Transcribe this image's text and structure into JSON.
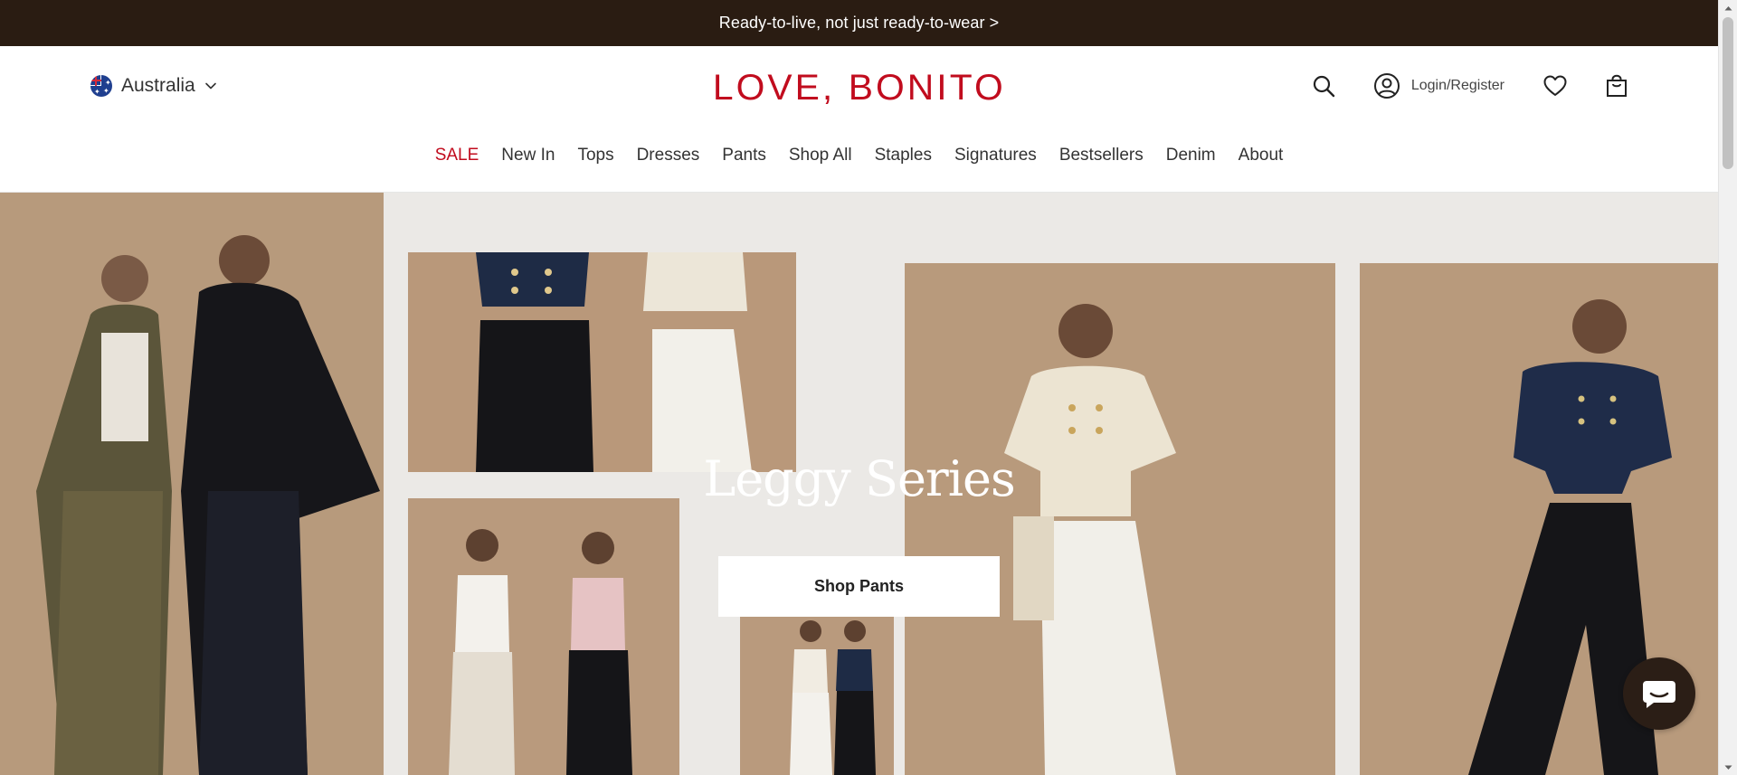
{
  "announcement": {
    "text": "Ready-to-live, not just ready-to-wear >"
  },
  "header": {
    "region": {
      "label": "Australia",
      "flag_icon": "australia-flag-icon"
    },
    "logo": "LOVE, BONITO",
    "login_label": "Login/Register",
    "icons": [
      "search-icon",
      "account-icon",
      "heart-icon",
      "shopping-bag-icon"
    ]
  },
  "nav": {
    "items": [
      {
        "label": "SALE",
        "highlight": true
      },
      {
        "label": "New In"
      },
      {
        "label": "Tops"
      },
      {
        "label": "Dresses"
      },
      {
        "label": "Pants"
      },
      {
        "label": "Shop All"
      },
      {
        "label": "Staples"
      },
      {
        "label": "Signatures"
      },
      {
        "label": "Bestsellers"
      },
      {
        "label": "Denim"
      },
      {
        "label": "About"
      }
    ]
  },
  "hero": {
    "title": "Leggy Series",
    "cta_label": "Shop Pants"
  },
  "colors": {
    "announce_bg": "#2a1c12",
    "brand": "#c10c1e",
    "hero_bg": "#ebe9e6",
    "tan": "#b99b7f",
    "chat_bg": "#2b1e16"
  }
}
